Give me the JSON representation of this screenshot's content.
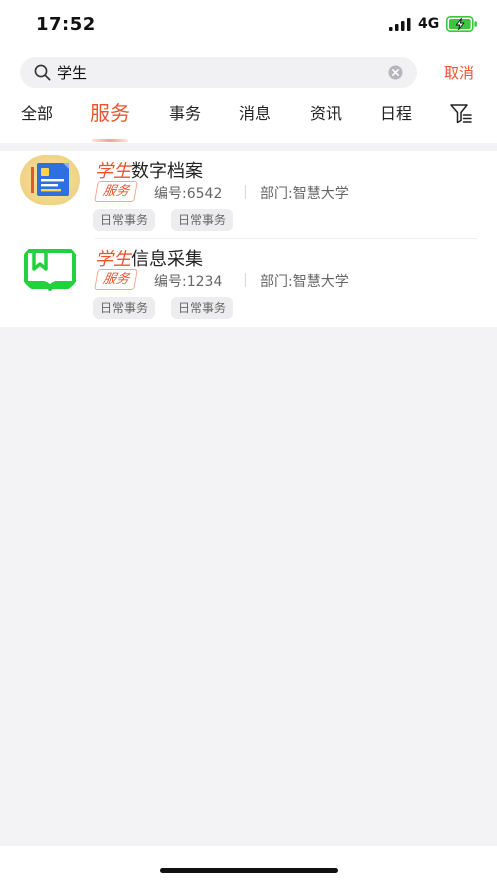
{
  "status_bar": {
    "time": "17:52",
    "network": "4G",
    "battery_color": "#3ec43e"
  },
  "search": {
    "query": "学生",
    "cancel_label": "取消"
  },
  "tabs": [
    {
      "label": "全部",
      "active": false
    },
    {
      "label": "服务",
      "active": true
    },
    {
      "label": "事务",
      "active": false
    },
    {
      "label": "消息",
      "active": false
    },
    {
      "label": "资讯",
      "active": false
    },
    {
      "label": "日程",
      "active": false
    }
  ],
  "results": [
    {
      "title_highlight": "学生",
      "title_rest": "数字档案",
      "badge": "服务",
      "code": "编号:6542",
      "department": "部门:智慧大学",
      "tags": [
        "日常事务",
        "日常事务"
      ],
      "icon": "digital-archive-icon"
    },
    {
      "title_highlight": "学生",
      "title_rest": "信息采集",
      "badge": "服务",
      "code": "编号:1234",
      "department": "部门:智慧大学",
      "tags": [
        "日常事务",
        "日常事务"
      ],
      "icon": "info-collection-icon"
    }
  ],
  "colors": {
    "accent": "#e8552f",
    "background": "#f3f3f5",
    "tag_bg": "#ededef",
    "icon_green": "#22d13d",
    "icon_blue": "#2f6fe0"
  }
}
